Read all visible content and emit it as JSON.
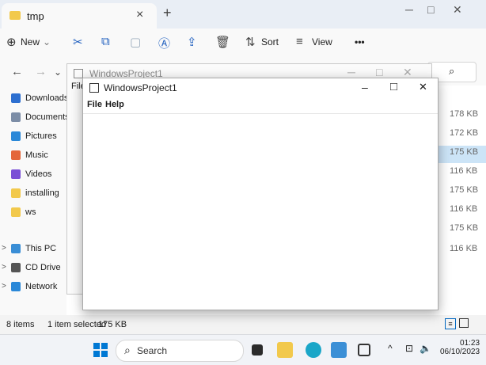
{
  "explorer": {
    "tab_title": "tmp",
    "toolbar": {
      "new_label": "New",
      "sort_label": "Sort",
      "view_label": "View",
      "more_label": "•••"
    },
    "sidebar": {
      "items": [
        {
          "label": "Downloads",
          "icon": "download-icon"
        },
        {
          "label": "Documents",
          "icon": "document-icon"
        },
        {
          "label": "Pictures",
          "icon": "pictures-icon"
        },
        {
          "label": "Music",
          "icon": "music-icon"
        },
        {
          "label": "Videos",
          "icon": "videos-icon"
        },
        {
          "label": "installing",
          "icon": "folder-icon"
        },
        {
          "label": "ws",
          "icon": "folder-icon"
        },
        {
          "label": "This PC",
          "icon": "pc-icon"
        },
        {
          "label": "CD Drive",
          "icon": "drive-icon"
        },
        {
          "label": "Network",
          "icon": "network-icon"
        }
      ]
    },
    "file_sizes": [
      "178 KB",
      "172 KB",
      "175 KB",
      "116 KB",
      "175 KB",
      "116 KB",
      "175 KB",
      "116 KB"
    ],
    "status": {
      "items_count": "8 items",
      "selection": "1 item selected",
      "selection_size": "175 KB"
    }
  },
  "bg_window": {
    "title": "WindowsProject1",
    "menu_partial": "File"
  },
  "app_window": {
    "title": "WindowsProject1",
    "menu": [
      "File",
      "Help"
    ],
    "min_symbol": "–",
    "max_symbol": "□",
    "close_symbol": "✕"
  },
  "taskbar": {
    "search_label": "Search",
    "time": "01:23",
    "date": "06/10/2023"
  },
  "colors": {
    "accent": "#0067c0",
    "selection": "#cce4f7",
    "folder": "#f2c94c"
  }
}
